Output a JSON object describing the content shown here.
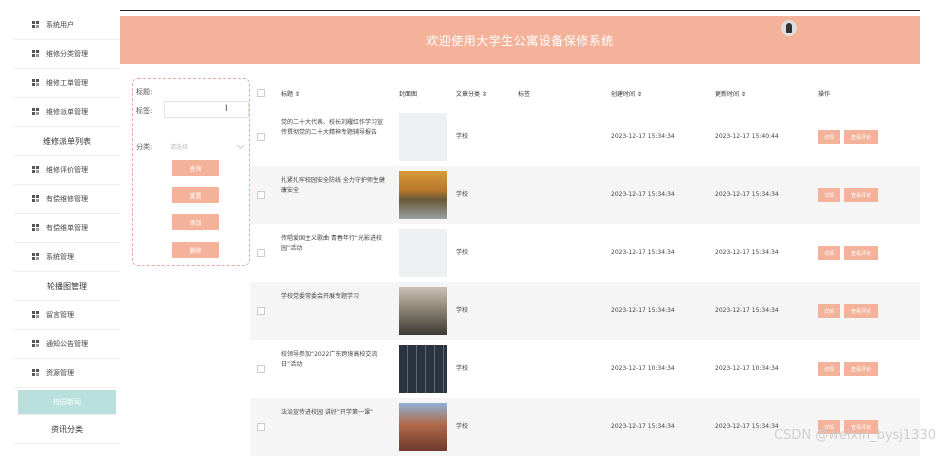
{
  "sidebar": {
    "items": [
      {
        "label": "系统用户",
        "icon": "grid-icon",
        "style": "icon"
      },
      {
        "label": "维修分类管理",
        "icon": "grid-icon",
        "style": "icon"
      },
      {
        "label": "维修工单管理",
        "icon": "grid-icon",
        "style": "icon"
      },
      {
        "label": "维修派单管理",
        "icon": "grid-icon",
        "style": "icon"
      },
      {
        "label": "维修派单列表",
        "style": "center"
      },
      {
        "label": "维修评价管理",
        "icon": "grid-icon",
        "style": "icon"
      },
      {
        "label": "有偿维修管理",
        "icon": "grid-icon",
        "style": "icon"
      },
      {
        "label": "有偿维单管理",
        "icon": "grid-icon",
        "style": "icon"
      },
      {
        "label": "系统管理",
        "icon": "grid-icon",
        "style": "icon"
      },
      {
        "label": "轮播图管理",
        "style": "center"
      },
      {
        "label": "留言管理",
        "icon": "grid-icon",
        "style": "icon"
      },
      {
        "label": "通知公告管理",
        "icon": "grid-icon",
        "style": "icon"
      },
      {
        "label": "资源管理",
        "icon": "grid-icon",
        "style": "icon"
      },
      {
        "label": "校园新闻",
        "style": "active"
      },
      {
        "label": "资讯分类",
        "style": "center"
      }
    ]
  },
  "header": {
    "title": "欢迎使用大学生公寓设备保修系统"
  },
  "filter": {
    "title_label": "标题:",
    "title_value": "",
    "label2": "标签:",
    "category_label": "分类:",
    "category_placeholder": "请选择",
    "buttons": [
      "查询",
      "重置",
      "添加",
      "删除"
    ]
  },
  "table": {
    "headers": [
      "标题 ⇕",
      "封面图",
      "文章分类 ⇕",
      "标签",
      "创建时间 ⇕",
      "更新时间 ⇕",
      "操作"
    ],
    "rows": [
      {
        "title": "党的二十大代表、校长刘耀红作学习宣传贯彻党的二十大精神专题辅导报告",
        "category": "学校",
        "created": "2023-12-17 15:34:34",
        "updated": "2023-12-17 15:40:44",
        "cover": "blank"
      },
      {
        "title": "扎紧扎牢校园安全防线 全力守护师生健康安全",
        "category": "学校",
        "created": "2023-12-17 15:34:34",
        "updated": "2023-12-17 15:34:34",
        "cover": "autumn-trees"
      },
      {
        "title": "传唱爱国主义歌曲 青春年行“光影进校园”活动",
        "category": "学校",
        "created": "2023-12-17 15:34:34",
        "updated": "2023-12-17 15:34:34",
        "cover": "blank"
      },
      {
        "title": "学校党委常委会开展专题学习",
        "category": "学校",
        "created": "2023-12-17 15:34:34",
        "updated": "2023-12-17 15:34:34",
        "cover": "meeting"
      },
      {
        "title": "校领导参加“2022广东跨境高校交流日”活动",
        "category": "学校",
        "created": "2023-12-17 10:34:34",
        "updated": "2023-12-17 10:34:34",
        "cover": "video-grid"
      },
      {
        "title": "法治宣传进校园 讲好“开学第一课”",
        "category": "学校",
        "created": "2023-12-17 15:34:34",
        "updated": "2023-12-17 15:34:34",
        "cover": "building"
      }
    ],
    "action_detail": "详情",
    "action_review": "查看评论"
  },
  "watermark": "CSDN @weixin_bysj1330",
  "colors": {
    "accent": "#f5b29a",
    "active": "#b9e0dc"
  }
}
